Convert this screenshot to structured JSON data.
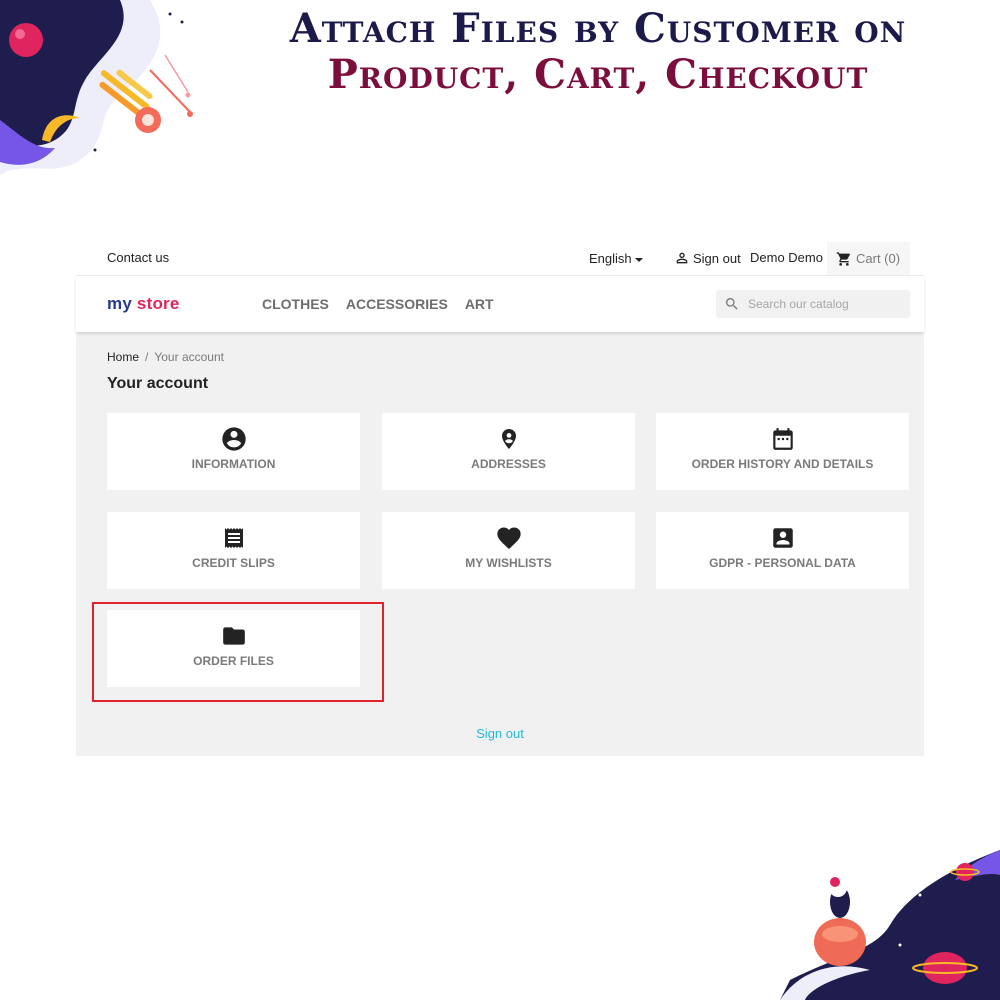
{
  "promo": {
    "headline_line1": "Attach Files by Customer on",
    "headline_line2": "Product, Cart, Checkout"
  },
  "topbar": {
    "contact": "Contact us",
    "language": "English",
    "sign_out": "Sign out",
    "customer_name": "Demo Demo",
    "cart": "Cart (0)"
  },
  "header": {
    "logo_parts": [
      "my",
      "store"
    ],
    "menu": [
      "CLOTHES",
      "ACCESSORIES",
      "ART"
    ],
    "search_placeholder": "Search our catalog"
  },
  "breadcrumb": {
    "home": "Home",
    "separator": "/",
    "current": "Your account"
  },
  "page_title": "Your account",
  "tiles": [
    {
      "label": "INFORMATION",
      "icon": "account-circle-icon"
    },
    {
      "label": "ADDRESSES",
      "icon": "location-pin-icon"
    },
    {
      "label": "ORDER HISTORY AND DETAILS",
      "icon": "calendar-icon"
    },
    {
      "label": "CREDIT SLIPS",
      "icon": "receipt-icon"
    },
    {
      "label": "MY WISHLISTS",
      "icon": "heart-icon"
    },
    {
      "label": "GDPR - PERSONAL DATA",
      "icon": "account-box-icon"
    },
    {
      "label": "ORDER FILES",
      "icon": "folder-icon"
    }
  ],
  "footer_link": "Sign out",
  "colors": {
    "highlight": "#e0222c",
    "link": "#24b9d7",
    "headline_dark": "#1c1a4a",
    "headline_accent": "#7b0e3d"
  }
}
